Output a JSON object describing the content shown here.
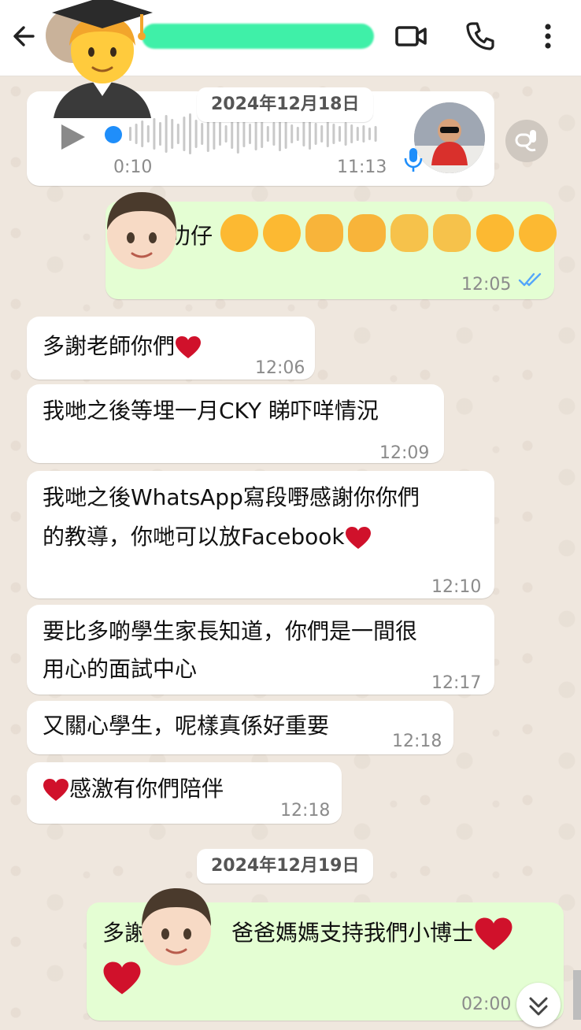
{
  "header": {
    "contact_name": "",
    "icons": [
      "back-arrow-icon",
      "video-call-icon",
      "phone-icon",
      "more-vert-icon"
    ]
  },
  "dates": [
    "2024年12月18日",
    "2024年12月19日"
  ],
  "voice_message": {
    "duration": "0:10",
    "time": "11:13",
    "progress": 0
  },
  "messages": [
    {
      "dir": "out",
      "text": "叻仔",
      "time": "12:05",
      "status": "read"
    },
    {
      "dir": "in",
      "text": "多謝老師你們",
      "time": "12:06"
    },
    {
      "dir": "in",
      "text": "我哋之後等埋一月CKY 睇吓咩情況",
      "time": "12:09"
    },
    {
      "dir": "in",
      "text_line1": "我哋之後WhatsApp寫段嘢感謝你你們",
      "text_line2": "的教導，你哋可以放Facebook",
      "time": "12:10"
    },
    {
      "dir": "in",
      "text_line1": "要比多啲學生家長知道，你們是一間很",
      "text_line2": "用心的面試中心",
      "time": "12:17"
    },
    {
      "dir": "in",
      "text": "又關心學生，呢樣真係好重要",
      "time": "12:18"
    },
    {
      "dir": "in",
      "text": "感激有你們陪伴",
      "time": "12:18"
    },
    {
      "dir": "out",
      "text_pre": "多謝",
      "text_post": "爸爸媽媽支持我們小博士",
      "time": "02:00",
      "status": "sent"
    }
  ],
  "colors": {
    "incoming": "#ffffff",
    "outgoing": "#e4fed3",
    "wallpaper": "#efe7de",
    "read_tick": "#53a6fa",
    "heart": "#d0112b",
    "redaction": "#3ff0a8"
  }
}
